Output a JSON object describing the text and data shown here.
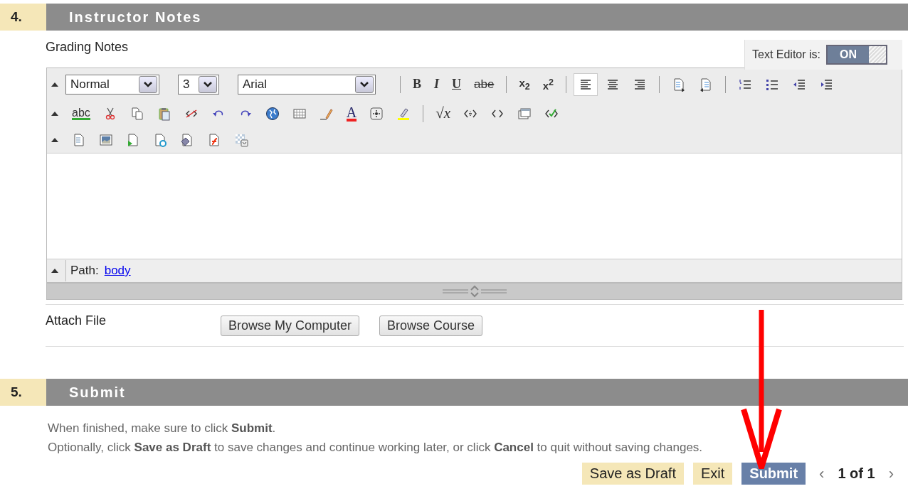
{
  "sections": [
    {
      "number": "4.",
      "title": "Instructor Notes"
    },
    {
      "number": "5.",
      "title": "Submit"
    }
  ],
  "grading_notes": {
    "label": "Grading Notes"
  },
  "text_editor_toggle": {
    "label": "Text Editor is:",
    "state_label": "ON",
    "on": true
  },
  "toolbar": {
    "rows": [
      [
        {
          "kind": "select",
          "value": "Normal"
        },
        {
          "kind": "select",
          "value": "3"
        },
        {
          "kind": "select",
          "value": "Arial"
        },
        {
          "kind": "separator"
        },
        {
          "kind": "bold",
          "glyph": "B",
          "selected": false
        },
        {
          "kind": "italic",
          "glyph": "I",
          "selected": false
        },
        {
          "kind": "underline",
          "glyph": "U",
          "selected": false
        },
        {
          "kind": "strike",
          "glyph": "abe",
          "selected": false
        },
        {
          "kind": "separator"
        },
        {
          "kind": "subscript",
          "glyph": "x$_{2}$",
          "selected": false
        },
        {
          "kind": "superscript",
          "glyph": "x$^{2}$",
          "selected": false
        },
        {
          "kind": "separator"
        },
        {
          "kind": "align-left",
          "selected": true
        },
        {
          "kind": "align-center",
          "selected": false
        },
        {
          "kind": "align-right",
          "selected": false
        },
        {
          "kind": "separator"
        },
        {
          "kind": "doc-out",
          "selected": false
        },
        {
          "kind": "doc-in",
          "selected": false
        },
        {
          "kind": "separator"
        },
        {
          "kind": "ordered-list",
          "selected": false
        },
        {
          "kind": "bullet-list",
          "selected": false
        },
        {
          "kind": "outdent",
          "selected": false
        },
        {
          "kind": "indent",
          "selected": false
        }
      ],
      [
        {
          "kind": "spellcheck",
          "glyph": "abc",
          "selected": false
        },
        {
          "kind": "cut",
          "selected": false
        },
        {
          "kind": "copy",
          "selected": false
        },
        {
          "kind": "paste",
          "selected": false
        },
        {
          "kind": "unlink",
          "selected": false
        },
        {
          "kind": "undo",
          "selected": false
        },
        {
          "kind": "redo",
          "selected": false
        },
        {
          "kind": "globe",
          "selected": false
        },
        {
          "kind": "table",
          "selected": false
        },
        {
          "kind": "pencil",
          "selected": false
        },
        {
          "kind": "font-color",
          "glyph": "A",
          "selected": false
        },
        {
          "kind": "object",
          "selected": false
        },
        {
          "kind": "highlight",
          "selected": false
        },
        {
          "kind": "separator"
        },
        {
          "kind": "math",
          "glyph": "√x",
          "selected": false
        },
        {
          "kind": "html-tag",
          "selected": false
        },
        {
          "kind": "code",
          "selected": false
        },
        {
          "kind": "window",
          "selected": false
        },
        {
          "kind": "check-code",
          "selected": false
        }
      ],
      [
        {
          "kind": "page",
          "selected": false
        },
        {
          "kind": "image",
          "selected": false
        },
        {
          "kind": "media",
          "selected": false
        },
        {
          "kind": "quicktime",
          "selected": false
        },
        {
          "kind": "mashup",
          "selected": false
        },
        {
          "kind": "flash",
          "selected": false
        },
        {
          "kind": "background",
          "selected": false
        }
      ]
    ]
  },
  "path_bar": {
    "label": "Path:",
    "link": "body"
  },
  "attach_file": {
    "label": "Attach File",
    "buttons": [
      "Browse My Computer",
      "Browse Course"
    ]
  },
  "submit_text": [
    "When finished, make sure to click **Submit**.",
    "Optionally, click **Save as Draft** to save changes and continue working later, or click **Cancel** to quit without saving changes."
  ],
  "actions": [
    {
      "label": "Save as Draft",
      "kind": "secondary"
    },
    {
      "label": "Exit",
      "kind": "secondary"
    },
    {
      "label": "Submit",
      "kind": "primary"
    }
  ],
  "pager": {
    "prev": "‹",
    "text": "1 of 1",
    "next": "›"
  }
}
